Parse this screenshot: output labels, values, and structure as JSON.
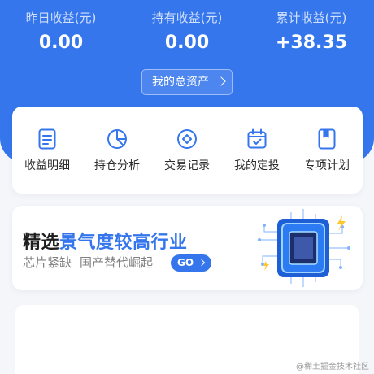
{
  "stats": [
    {
      "label": "昨日收益(元)",
      "value": "0.00"
    },
    {
      "label": "持有收益(元)",
      "value": "0.00"
    },
    {
      "label": "累计收益(元)",
      "value": "+38.35"
    }
  ],
  "assets_button": {
    "label": "我的总资产"
  },
  "menu": [
    {
      "label": "收益明细",
      "icon": "document-icon"
    },
    {
      "label": "持仓分析",
      "icon": "pie-chart-icon"
    },
    {
      "label": "交易记录",
      "icon": "diamond-circle-icon"
    },
    {
      "label": "我的定投",
      "icon": "calendar-check-icon"
    },
    {
      "label": "专项计划",
      "icon": "bookmark-icon"
    }
  ],
  "banner": {
    "title_part1": "精选",
    "title_part2": "景气度较高行业",
    "subtitle_1": "芯片紧缺",
    "subtitle_2": "国产替代崛起",
    "go_label": "GO"
  },
  "watermark": "@稀土掘金技术社区",
  "colors": {
    "primary": "#3576ed",
    "background": "#f4f6fa"
  }
}
